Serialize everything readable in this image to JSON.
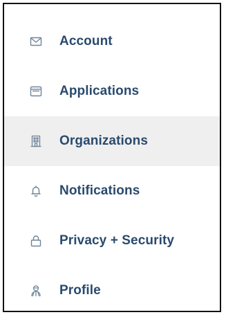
{
  "colors": {
    "icon": "#6f849a",
    "label": "#2a4a6e",
    "active_background": "#efefef",
    "border": "#111111"
  },
  "menu": {
    "active_item": "Organizations",
    "items": [
      {
        "label": "Account",
        "icon": "envelope-icon"
      },
      {
        "label": "Applications",
        "icon": "browser-window-icon"
      },
      {
        "label": "Organizations",
        "icon": "building-icon"
      },
      {
        "label": "Notifications",
        "icon": "bell-icon"
      },
      {
        "label": "Privacy + Security",
        "icon": "lock-icon"
      },
      {
        "label": "Profile",
        "icon": "user-icon"
      }
    ]
  }
}
